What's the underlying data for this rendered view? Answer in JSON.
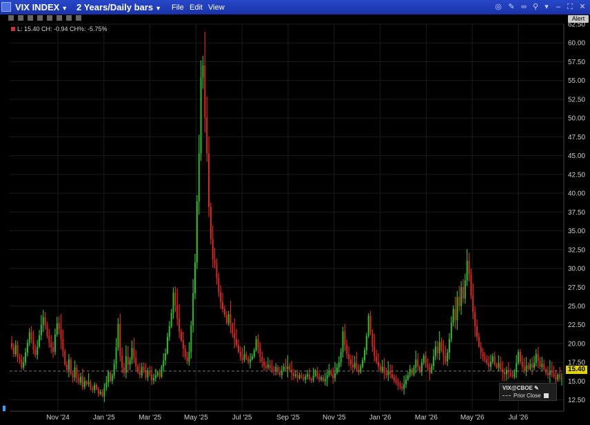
{
  "window": {
    "symbol": "VIX INDEX",
    "period": "2 Years/Daily bars",
    "menu": [
      "File",
      "Edit",
      "View"
    ],
    "alert_label": "Alert"
  },
  "info_line": "L: 15.40 CH: -0.94 CH%: -5.75%",
  "legend": {
    "series": "VIX@CBOE",
    "prior_close": "Prior Close"
  },
  "last_price": "15.40",
  "colors": {
    "up": "#22c322",
    "down": "#e0251e",
    "titlebar": "#1f3cb8",
    "price_tag": "#e2d400"
  },
  "chart_data": {
    "type": "candlestick",
    "title": "",
    "xlabel": "",
    "ylabel": "",
    "ylim": [
      11.0,
      62.5
    ],
    "y_ticks": [
      "62.50",
      "60.00",
      "57.50",
      "55.00",
      "52.50",
      "50.00",
      "47.50",
      "45.00",
      "42.50",
      "40.00",
      "37.50",
      "35.00",
      "32.50",
      "30.00",
      "27.50",
      "25.00",
      "22.50",
      "20.00",
      "17.50",
      "15.00",
      "12.50"
    ],
    "x_ticks": [
      "Nov '24",
      "Jan '25",
      "Mar '25",
      "May '25",
      "Jul '25",
      "Sep '25",
      "Nov '25",
      "Jan '26",
      "Mar '26",
      "May '26",
      "Jul '26"
    ],
    "grid": true,
    "prior_close": 16.34,
    "last": 15.4,
    "series": [
      {
        "name": "VIX@CBOE",
        "values": [
          19.5,
          18.6,
          19.8,
          18.2,
          17.9,
          16.8,
          17.5,
          18.8,
          20.1,
          21.5,
          20.5,
          19.2,
          18.5,
          19.6,
          21.1,
          22.5,
          23.5,
          22.4,
          21.0,
          20.1,
          19.5,
          18.9,
          21.2,
          22.7,
          21.9,
          20.6,
          19.0,
          17.2,
          16.5,
          17.9,
          16.0,
          15.5,
          16.8,
          15.4,
          14.8,
          15.6,
          14.2,
          15.0,
          14.6,
          14.9,
          14.1,
          13.8,
          14.5,
          13.9,
          13.3,
          13.6,
          13.0,
          14.1,
          14.8,
          16.2,
          15.0,
          15.8,
          17.3,
          19.5,
          22.6,
          18.4,
          16.8,
          16.1,
          18.3,
          17.2,
          17.8,
          19.4,
          18.1,
          17.0,
          16.2,
          15.8,
          16.9,
          16.3,
          15.5,
          16.4,
          15.9,
          15.1,
          15.4,
          15.8,
          16.2,
          15.6,
          16.9,
          17.8,
          18.7,
          20.9,
          22.3,
          24.1,
          26.8,
          25.1,
          23.3,
          21.6,
          20.4,
          19.3,
          18.2,
          17.6,
          18.9,
          22.4,
          26.7,
          30.8,
          38.9,
          45.3,
          55.4,
          57.0,
          50.1,
          45.3,
          38.2,
          33.9,
          31.2,
          30.5,
          28.7,
          26.9,
          25.5,
          24.6,
          23.8,
          22.7,
          23.9,
          22.5,
          21.4,
          20.6,
          19.8,
          18.9,
          18.2,
          17.8,
          18.6,
          18.1,
          17.5,
          17.9,
          18.3,
          19.1,
          20.6,
          19.4,
          18.2,
          17.6,
          17.0,
          16.8,
          17.2,
          16.7,
          16.5,
          16.3,
          16.9,
          16.2,
          15.8,
          16.4,
          16.9,
          16.6,
          17.0,
          16.5,
          16.1,
          15.7,
          15.9,
          15.4,
          15.8,
          15.5,
          15.2,
          15.6,
          15.9,
          15.3,
          15.1,
          15.7,
          16.4,
          15.6,
          15.2,
          15.5,
          15.0,
          15.3,
          15.8,
          16.3,
          15.9,
          15.4,
          16.1,
          16.8,
          17.5,
          18.9,
          21.6,
          19.8,
          18.6,
          17.9,
          17.2,
          16.8,
          17.4,
          16.6,
          16.2,
          16.9,
          17.8,
          19.1,
          21.0,
          23.7,
          21.4,
          19.6,
          18.3,
          17.6,
          17.0,
          16.4,
          16.9,
          16.1,
          15.8,
          16.4,
          15.9,
          15.5,
          15.1,
          14.8,
          14.5,
          14.3,
          14.0,
          14.6,
          15.2,
          15.8,
          16.6,
          15.9,
          16.8,
          17.9,
          16.9,
          16.2,
          17.5,
          18.4,
          17.3,
          16.8,
          16.1,
          17.0,
          18.3,
          19.6,
          18.7,
          20.2,
          19.1,
          18.4,
          17.6,
          18.8,
          20.6,
          22.8,
          24.6,
          23.1,
          26.2,
          25.0,
          27.5,
          26.0,
          28.4,
          31.0,
          29.2,
          26.4,
          24.2,
          22.3,
          20.9,
          19.6,
          18.8,
          18.2,
          17.9,
          17.4,
          16.9,
          17.6,
          18.3,
          17.2,
          16.8,
          17.4,
          16.6,
          16.2,
          15.9,
          16.5,
          16.1,
          15.8,
          15.6,
          16.2,
          17.4,
          18.9,
          17.6,
          16.9,
          16.3,
          17.1,
          16.6,
          17.3,
          16.8,
          17.4,
          18.6,
          17.7,
          16.9,
          17.3,
          16.6,
          16.1,
          15.8,
          16.4,
          16.0,
          15.6,
          15.2,
          15.9,
          15.4,
          15.4
        ]
      }
    ]
  }
}
